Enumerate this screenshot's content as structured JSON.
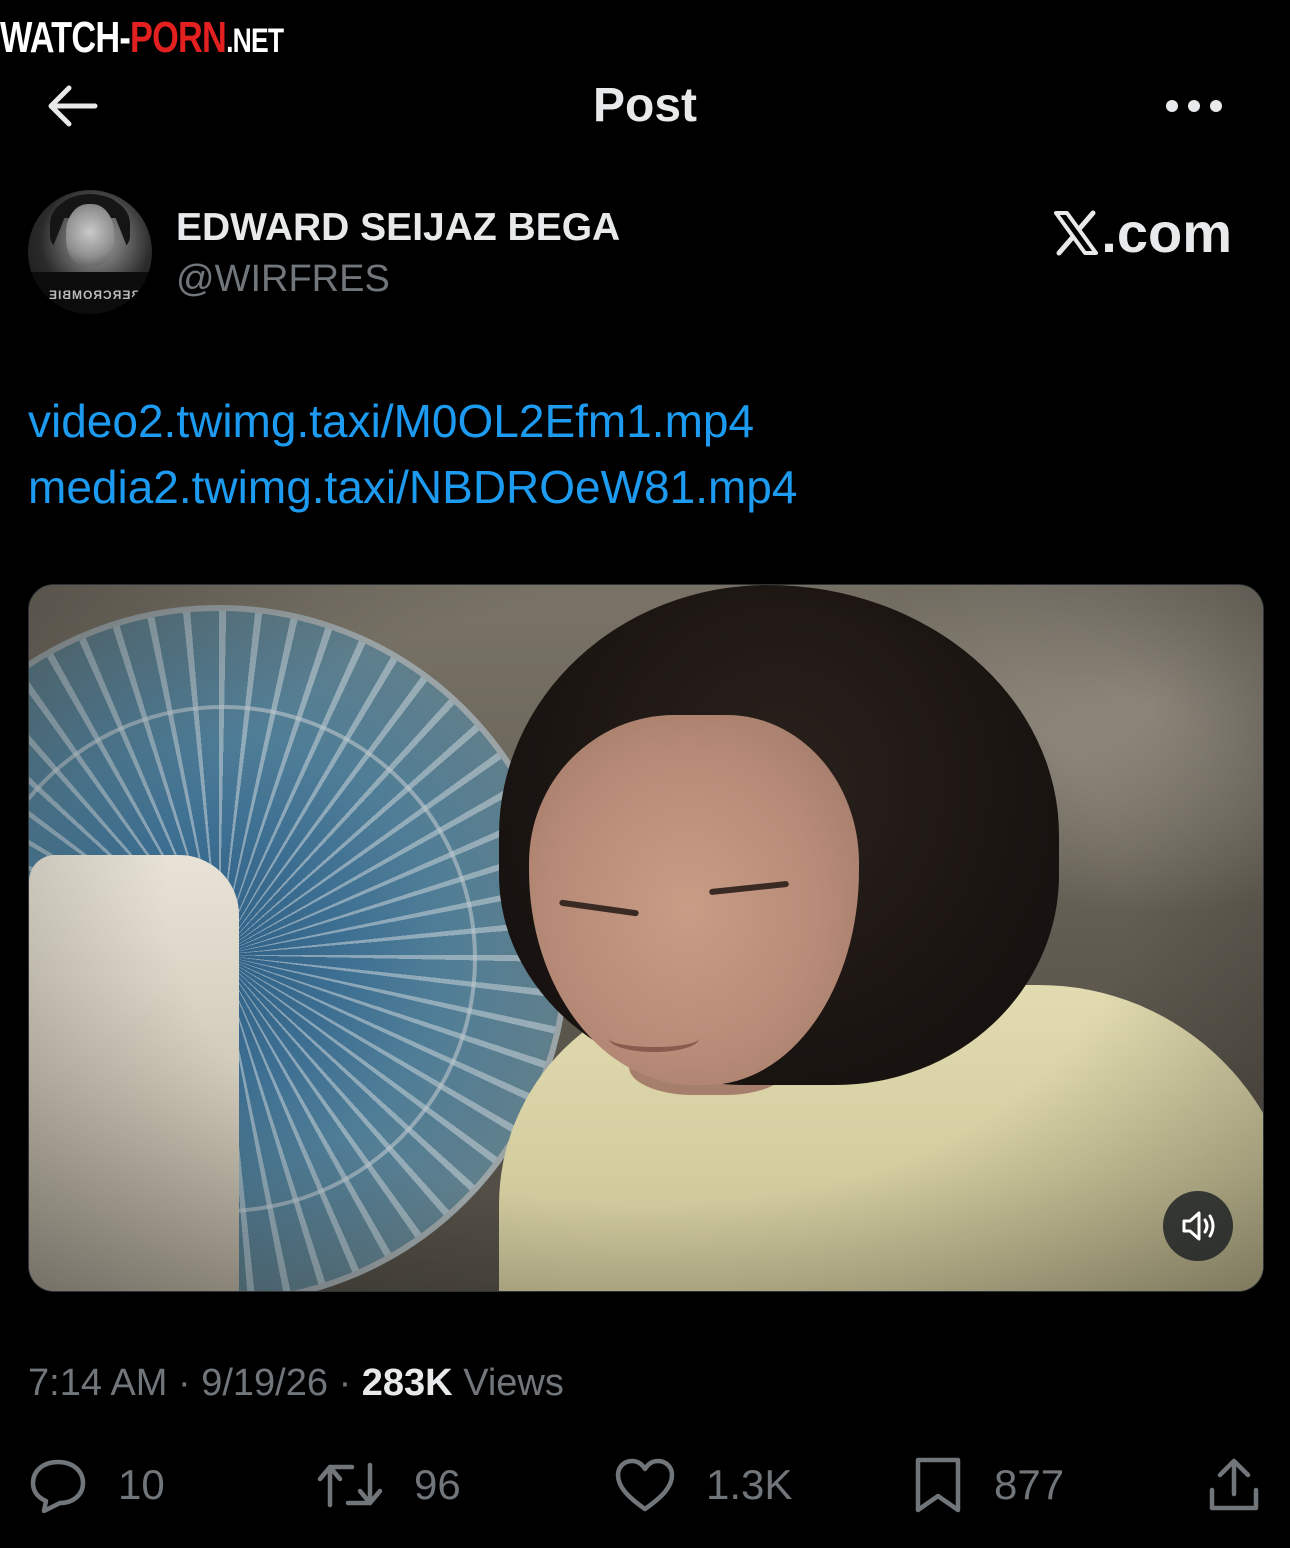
{
  "watermark": {
    "part1": "WATCH-",
    "part2": "PORN",
    "part3": ".NET"
  },
  "header": {
    "title": "Post"
  },
  "author": {
    "display_name": "EDWARD SEIJAZ BEGA",
    "handle": "@WIRFRES",
    "avatar_text": "ABERCROMBIE",
    "site_label": ".com"
  },
  "post": {
    "links": [
      "video2.twimg.taxi/M0OL2Efm1.mp4",
      "media2.twimg.taxi/NBDROeW81.mp4"
    ]
  },
  "meta": {
    "time": "7:14 AM",
    "sep1": "·",
    "date": "9/19/26",
    "sep2": "·",
    "views_count": "283K",
    "views_label": "Views"
  },
  "actions": {
    "replies": "10",
    "reposts": "96",
    "likes": "1.3K",
    "bookmarks": "877"
  },
  "icons": {
    "back": "arrow-left-icon",
    "more": "more-horizontal-icon",
    "x_logo": "x-logo-icon",
    "volume": "speaker-muted-icon",
    "reply": "reply-bubble-icon",
    "repost": "repost-icon",
    "like": "heart-icon",
    "bookmark": "bookmark-icon",
    "share": "share-icon"
  },
  "colors": {
    "background": "#000000",
    "text": "#e7e9ea",
    "secondary": "#71767b",
    "link": "#1d9bf0",
    "watermark_red": "#e32020"
  }
}
